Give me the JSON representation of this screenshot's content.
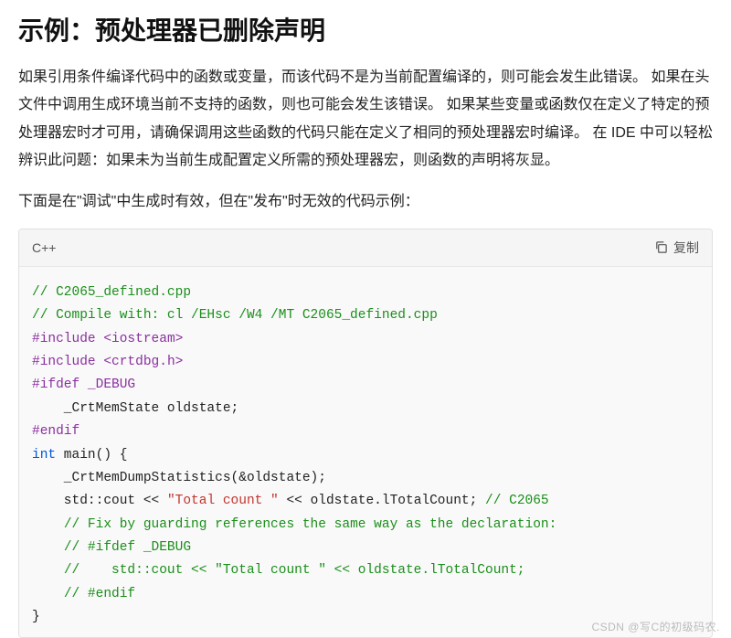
{
  "title": "示例：预处理器已删除声明",
  "para1": "如果引用条件编译代码中的函数或变量，而该代码不是为当前配置编译的，则可能会发生此错误。 如果在头文件中调用生成环境当前不支持的函数，则也可能会发生该错误。 如果某些变量或函数仅在定义了特定的预处理器宏时才可用，请确保调用这些函数的代码只能在定义了相同的预处理器宏时编译。 在 IDE 中可以轻松辨识此问题：如果未为当前生成配置定义所需的预处理器宏，则函数的声明将灰显。",
  "para2": "下面是在\"调试\"中生成时有效，但在\"发布\"时无效的代码示例：",
  "code": {
    "lang": "C++",
    "copy_label": "复制",
    "lines": [
      {
        "cls": "c-comment",
        "t": "// C2065_defined.cpp"
      },
      {
        "cls": "c-comment",
        "t": "// Compile with: cl /EHsc /W4 /MT C2065_defined.cpp"
      },
      {
        "segs": [
          {
            "cls": "c-pre",
            "t": "#include "
          },
          {
            "cls": "c-pre",
            "t": "<iostream>"
          }
        ]
      },
      {
        "segs": [
          {
            "cls": "c-pre",
            "t": "#include "
          },
          {
            "cls": "c-pre",
            "t": "<crtdbg.h>"
          }
        ]
      },
      {
        "segs": [
          {
            "cls": "c-pre",
            "t": "#ifdef"
          },
          {
            "cls": "",
            "t": " "
          },
          {
            "cls": "c-pre",
            "t": "_DEBUG"
          }
        ]
      },
      {
        "segs": [
          {
            "cls": "",
            "t": "    _CrtMemState oldstate;"
          }
        ]
      },
      {
        "cls": "c-pre",
        "t": "#endif"
      },
      {
        "segs": [
          {
            "cls": "c-kw",
            "t": "int"
          },
          {
            "cls": "",
            "t": " main() {"
          }
        ]
      },
      {
        "segs": [
          {
            "cls": "",
            "t": "    _CrtMemDumpStatistics(&oldstate);"
          }
        ]
      },
      {
        "segs": [
          {
            "cls": "",
            "t": "    std::cout << "
          },
          {
            "cls": "c-str",
            "t": "\"Total count \""
          },
          {
            "cls": "",
            "t": " << oldstate.lTotalCount; "
          },
          {
            "cls": "c-comment",
            "t": "// C2065"
          }
        ]
      },
      {
        "segs": [
          {
            "cls": "",
            "t": "    "
          },
          {
            "cls": "c-comment",
            "t": "// Fix by guarding references the same way as the declaration:"
          }
        ]
      },
      {
        "segs": [
          {
            "cls": "",
            "t": "    "
          },
          {
            "cls": "c-comment",
            "t": "// #ifdef _DEBUG"
          }
        ]
      },
      {
        "segs": [
          {
            "cls": "",
            "t": "    "
          },
          {
            "cls": "c-comment",
            "t": "//    std::cout << \"Total count \" << oldstate.lTotalCount;"
          }
        ]
      },
      {
        "segs": [
          {
            "cls": "",
            "t": "    "
          },
          {
            "cls": "c-comment",
            "t": "// #endif"
          }
        ]
      },
      {
        "segs": [
          {
            "cls": "",
            "t": "}"
          }
        ]
      }
    ]
  },
  "watermark": "CSDN @写C的初级码农."
}
